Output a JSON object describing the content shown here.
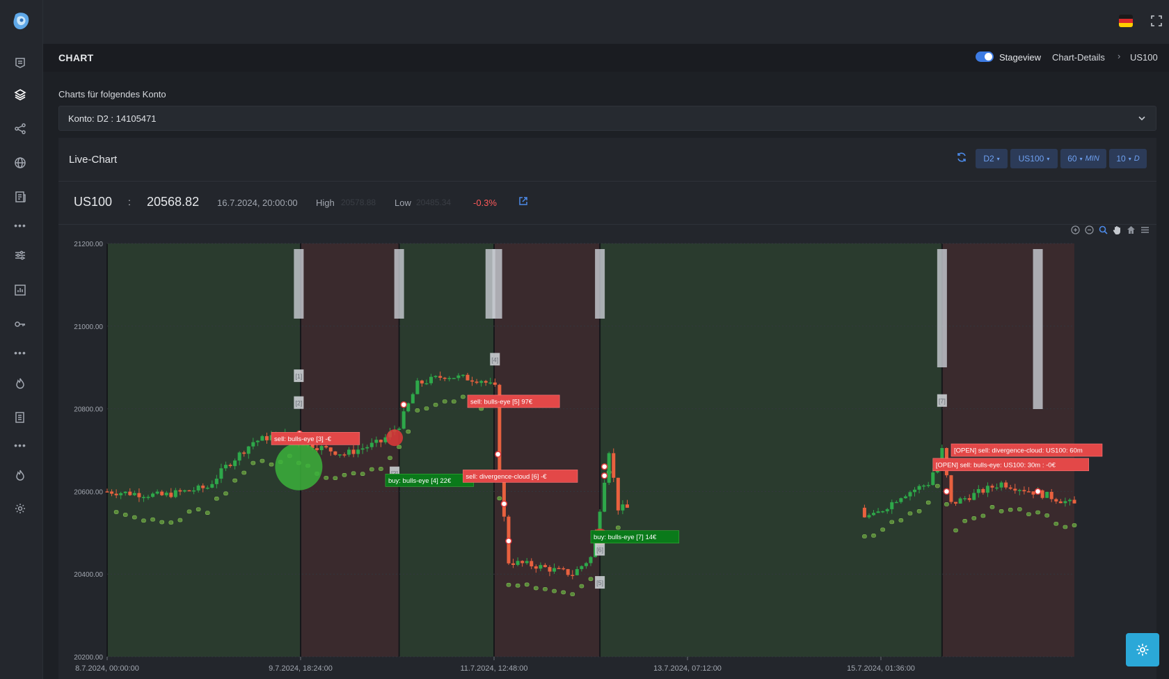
{
  "header": {
    "page_title": "CHART",
    "stageview_label": "Stageview",
    "stageview_on": true,
    "breadcrumb": [
      "Chart-Details",
      "US100"
    ]
  },
  "sidebar": {
    "items": [
      "news-icon",
      "layers-icon",
      "share-nodes-icon",
      "globe-icon",
      "newspaper-icon",
      "more-icon",
      "sliders-icon",
      "bar-report-icon",
      "key-icon",
      "more-icon",
      "flame-icon",
      "document-list-icon",
      "more-icon",
      "flame-icon",
      "gear-icon"
    ]
  },
  "account": {
    "label": "Charts für folgendes Konto",
    "selected": "Konto: D2 : 14105471"
  },
  "live_chart": {
    "title": "Live-Chart",
    "filters": {
      "account": "D2",
      "symbol": "US100",
      "interval_value": "60",
      "interval_unit": "MIN",
      "range_value": "10",
      "range_unit": "D"
    },
    "quote": {
      "symbol": "US100",
      "separator": ":",
      "price": "20568.82",
      "timestamp": "16.7.2024, 20:00:00",
      "high_label": "High",
      "high_value": "20578.88",
      "low_label": "Low",
      "low_value": "20485.34",
      "change": "-0.3%"
    }
  },
  "chart_data": {
    "type": "candlestick",
    "y_ticks": [
      "21200.00",
      "21000.00",
      "20800.00",
      "20600.00",
      "20400.00",
      "20200.00"
    ],
    "x_ticks": [
      "8.7.2024, 00:00:00",
      "9.7.2024, 18:24:00",
      "11.7.2024, 12:48:00",
      "13.7.2024, 07:12:00",
      "15.7.2024, 01:36:00"
    ],
    "ylim": [
      20200,
      21200
    ],
    "zones": [
      {
        "color": "green",
        "from": "8.7.2024, 00:00:00",
        "to": "9.7.2024, 18:24:00"
      },
      {
        "color": "red",
        "from": "9.7.2024, 18:24:00",
        "to": "10.7.2024, 16:00:00"
      },
      {
        "color": "green",
        "from": "10.7.2024, 16:00:00",
        "to": "11.7.2024, 12:48:00"
      },
      {
        "color": "red",
        "from": "11.7.2024, 12:48:00",
        "to": "12.7.2024, 12:00:00"
      },
      {
        "color": "green",
        "from": "12.7.2024, 12:00:00",
        "to": "15.7.2024, 15:00:00"
      },
      {
        "color": "red",
        "from": "15.7.2024, 15:00:00",
        "to": "16.7.2024, 20:00:00"
      }
    ],
    "trade_labels": [
      {
        "text": "sell: bulls-eye [3] -€",
        "color": "red"
      },
      {
        "text": "buy: bulls-eye [4] 22€",
        "color": "green"
      },
      {
        "text": "sell: bulls-eye [5] 97€",
        "color": "red"
      },
      {
        "text": "sell: divergence-cloud [6] -€",
        "color": "red"
      },
      {
        "text": "buy: bulls-eye [7] 14€",
        "color": "green"
      },
      {
        "text": "[OPEN] sell: bulls-eye: US100: 30m : -0€",
        "color": "red"
      },
      {
        "text": "[OPEN] sell: divergence-cloud: US100: 60m",
        "color": "red"
      }
    ],
    "marker_tags": [
      "[1]",
      "[2]",
      "[3]",
      "[4]",
      "[5]",
      "[6]",
      "[7]"
    ],
    "close_path": [
      [
        "8.7.2024, 00:00:00",
        20600
      ],
      [
        "8.7.2024, 12:00:00",
        20590
      ],
      [
        "8.7.2024, 22:00:00",
        20610
      ],
      [
        "9.7.2024, 02:00:00",
        20660
      ],
      [
        "9.7.2024, 08:00:00",
        20720
      ],
      [
        "9.7.2024, 14:00:00",
        20740
      ],
      [
        "9.7.2024, 18:24:00",
        20720
      ],
      [
        "10.7.2024, 04:00:00",
        20690
      ],
      [
        "10.7.2024, 12:00:00",
        20720
      ],
      [
        "10.7.2024, 16:00:00",
        20760
      ],
      [
        "10.7.2024, 20:00:00",
        20860
      ],
      [
        "11.7.2024, 02:00:00",
        20880
      ],
      [
        "11.7.2024, 10:00:00",
        20870
      ],
      [
        "11.7.2024, 13:00:00",
        20850
      ],
      [
        "11.7.2024, 14:00:00",
        20640
      ],
      [
        "11.7.2024, 16:00:00",
        20430
      ],
      [
        "11.7.2024, 22:00:00",
        20420
      ],
      [
        "12.7.2024, 06:00:00",
        20400
      ],
      [
        "12.7.2024, 10:00:00",
        20440
      ],
      [
        "12.7.2024, 12:00:00",
        20560
      ],
      [
        "12.7.2024, 14:00:00",
        20700
      ],
      [
        "12.7.2024, 16:00:00",
        20560
      ],
      [
        "15.7.2024, 00:00:00",
        20540
      ],
      [
        "15.7.2024, 06:00:00",
        20590
      ],
      [
        "15.7.2024, 12:00:00",
        20620
      ],
      [
        "15.7.2024, 15:00:00",
        20700
      ],
      [
        "15.7.2024, 17:00:00",
        20570
      ],
      [
        "16.7.2024, 04:00:00",
        20620
      ],
      [
        "16.7.2024, 14:00:00",
        20590
      ],
      [
        "16.7.2024, 20:00:00",
        20568
      ]
    ]
  },
  "colors": {
    "accent": "#3d7be3",
    "up": "#2ea84a",
    "down": "#e8613f",
    "zone_green": "#2a3b2e",
    "zone_red": "#3a2a2d",
    "fab": "#2ba8d8"
  }
}
